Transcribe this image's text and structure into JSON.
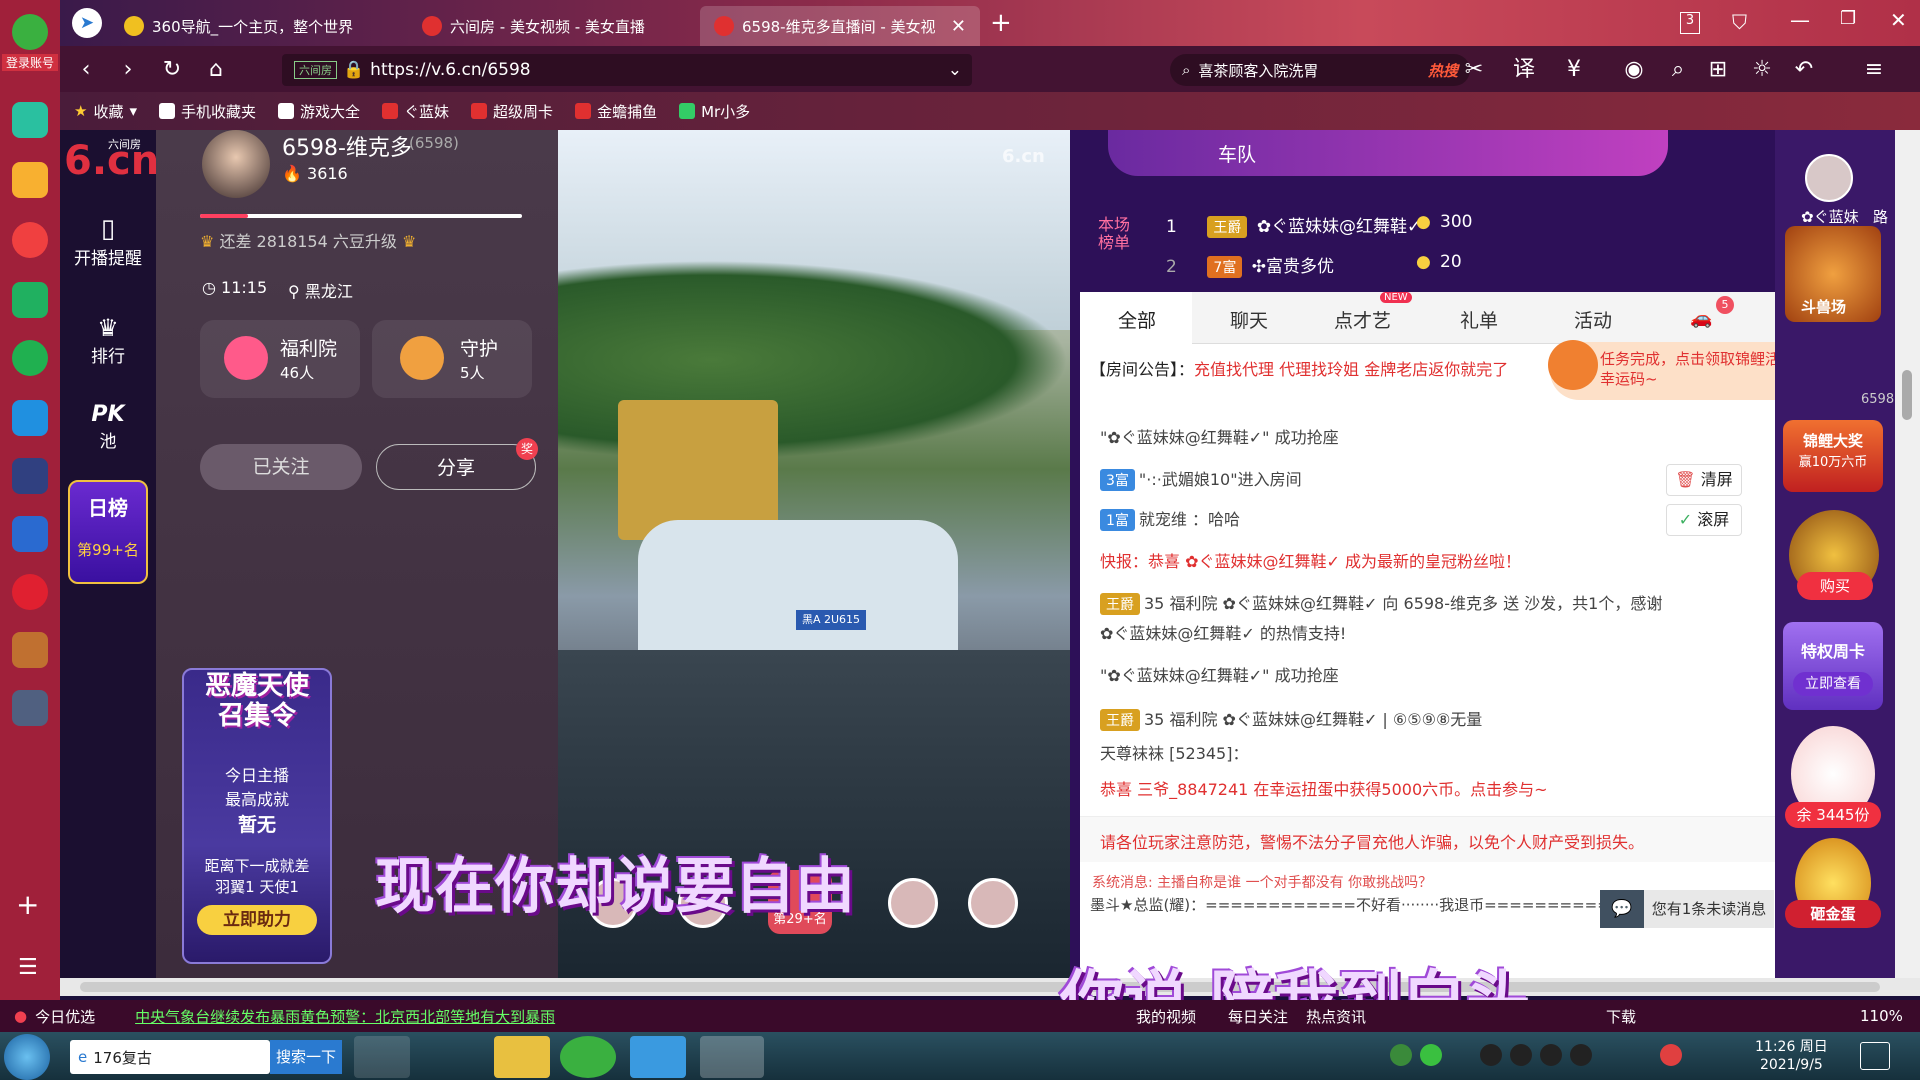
{
  "tabs": [
    {
      "label": "360导航_一个主页，整个世界"
    },
    {
      "label": "六间房 - 美女视频 - 美女直播"
    },
    {
      "label": "6598-维克多直播间 - 美女视"
    }
  ],
  "tabcount": "3",
  "sidebar_login": "登录账号",
  "url": "https://v.6.cn/6598",
  "url_secure_label": "六间房",
  "search": {
    "text": "喜茶顾客入院洗胃",
    "hot": "热搜"
  },
  "bookmarks": [
    "收藏",
    "手机收藏夹",
    "游戏大全",
    "ぐ蓝妹",
    "超级周卡",
    "金蟾捕鱼",
    "Mr小多"
  ],
  "nav6": {
    "logo": "6.cn",
    "logo_small": "六间房",
    "remind": "开播提醒",
    "rank": "排行",
    "pk": "PK",
    "pk_sub": "池",
    "daily": "日榜",
    "daily_rank": "第99+名"
  },
  "anchor": {
    "name": "6598-维克多",
    "id": "(6598)",
    "fans": "3616",
    "upgrade": "还差 2818154 六豆升级",
    "level_progress": 0.15,
    "time": "11:15",
    "location": "黑龙江",
    "welfare": "福利院",
    "welfare_count": "46人",
    "guard": "守护",
    "guard_count": "5人",
    "follow": "已关注",
    "share": "分享",
    "share_badge": "奖"
  },
  "promo": {
    "title": "恶魔天使召集令",
    "line1": "今日主播",
    "line2": "最高成就",
    "value": "暂无",
    "next": "距离下一成就差",
    "need": "羽翼1  天使1",
    "btn": "立即助力"
  },
  "video": {
    "watermark": "6.cn",
    "rank_badge": "第29+名",
    "plate": "黑A 2U615"
  },
  "overlay": {
    "lyric1": "现在你却说要自由",
    "lyric2": "你说  陪我到白头"
  },
  "chat": {
    "top_banner": "车队",
    "board_label": "本场榜单",
    "board": [
      {
        "rank": "1",
        "title": "王爵",
        "name": "✿ぐ蓝妹妹@红舞鞋✓",
        "coins": "300"
      },
      {
        "rank": "2",
        "title": "7富",
        "name": "✣富贵多优",
        "coins": "20"
      }
    ],
    "tabs": [
      "全部",
      "聊天",
      "点才艺",
      "礼单",
      "活动"
    ],
    "tab_new": "NEW",
    "tab_badge": "5",
    "notice_label": "【房间公告】：",
    "notice": "充值找代理 代理找玲姐 金牌老店返你就完了",
    "task": "任务完成，点击领取锦鲤活动幸运码~",
    "clear": "清屏",
    "scroll": "滚屏",
    "messages": [
      {
        "text": "\"✿ぐ蓝妹妹@红舞鞋✓\" 成功抢座"
      },
      {
        "badge": "3富",
        "text": "\"·:·武媚娘10\"进入房间"
      },
      {
        "badge": "1富",
        "text": "就宠维 ：哈哈"
      },
      {
        "text": "快报：恭喜 ✿ぐ蓝妹妹@红舞鞋✓ 成为最新的皇冠粉丝啦！"
      },
      {
        "badge": "王爵",
        "text": "35 福利院 ✿ぐ蓝妹妹@红舞鞋✓ 向 6598-维克多 送  沙发，共1个，感谢"
      },
      {
        "text": "✿ぐ蓝妹妹@红舞鞋✓ 的热情支持!"
      },
      {
        "text": "\"✿ぐ蓝妹妹@红舞鞋✓\" 成功抢座"
      },
      {
        "badge": "王爵",
        "text": "35 福利院 ✿ぐ蓝妹妹@红舞鞋✓ | ⑥⑤⑨⑧无量"
      },
      {
        "text": "天尊袜袜 [52345]："
      },
      {
        "text": "恭喜 三爷_8847241 在幸运扭蛋中获得5000六币。点击参与~"
      }
    ],
    "warning": "请各位玩家注意防范，警惕不法分子冒充他人诈骗，以免个人财产受到损失。",
    "sysmsg": "系统消息: 主播自称是谁    一个对手都没有    你敢挑战吗？",
    "bottom_msg": "墨斗★总监(耀)：============不好看········我退币=============",
    "unread": "您有1条未读消息"
  },
  "rcol": {
    "user": "✿ぐ蓝妹",
    "user2": "路",
    "arena": "斗兽场",
    "koi": "锦鲤大奖",
    "koi_sub": "赢10万六币",
    "num": "6598",
    "buy": "购买",
    "privilege": "特权周卡",
    "check": "立即查看",
    "remain": "余 3445份",
    "egg": "砸金蛋"
  },
  "status": {
    "today": "今日优选",
    "news": "中央气象台继续发布暴雨黄色预警：北京西北部等地有大到暴雨",
    "video": "我的视频",
    "follow": "每日关注",
    "hotnews": "热点资讯",
    "download": "下载",
    "zoom": "110%"
  },
  "taskbar": {
    "search_text": "176复古",
    "search_btn": "搜索一下",
    "time": "11:26 周日",
    "date": "2021/9/5"
  }
}
